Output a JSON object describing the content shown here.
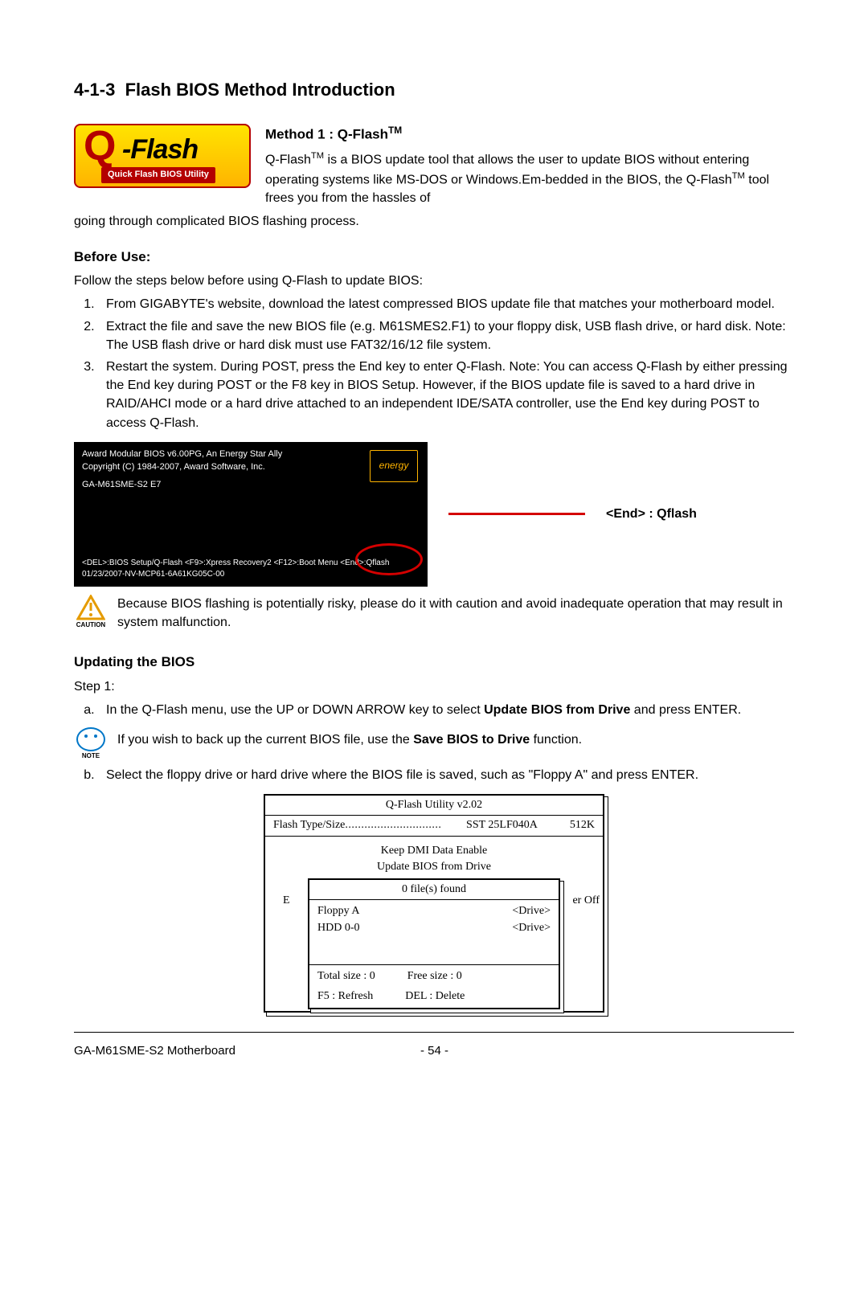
{
  "section": {
    "number": "4-1-3",
    "title": "Flash BIOS Method Introduction"
  },
  "logo": {
    "q": "Q",
    "flash": "-Flash",
    "tag": "Quick Flash BIOS Utility"
  },
  "method1": {
    "heading_prefix": "Method 1 : Q-Flash",
    "tm": "TM",
    "p1a": "Q-Flash",
    "p1b": " is a BIOS update tool that allows the user to update BIOS without entering operating systems like MS-DOS or Windows.Em-bedded in the BIOS, the Q-Flash",
    "p1c": " tool frees you from the hassles of",
    "p2": "going through complicated BIOS flashing process."
  },
  "before": {
    "head": "Before Use:",
    "intro": "Follow the steps below before using Q-Flash to update BIOS:",
    "steps": [
      "From GIGABYTE's website, download the latest compressed BIOS update file that matches your motherboard model.",
      "Extract the file and save the new BIOS file (e.g. M61SMES2.F1) to your floppy disk, USB flash drive, or hard disk. Note: The USB flash drive or hard disk must use FAT32/16/12 file system.",
      "Restart the system. During POST, press the End key to enter Q-Flash.  Note: You can access Q-Flash by either pressing the End key during POST or the F8 key in BIOS Setup. However, if the BIOS update file is saved to a hard drive in RAID/AHCI mode or a hard drive attached to an independent IDE/SATA controller, use the End key during POST to access Q-Flash."
    ]
  },
  "post": {
    "line1": "Award Modular BIOS v6.00PG, An Energy Star Ally",
    "line2": "Copyright (C) 1984-2007, Award Software, Inc.",
    "line3": "GA-M61SME-S2 E7",
    "bottom1": "<DEL>:BIOS Setup/Q-Flash <F9>:Xpress Recovery2 <F12>:Boot Menu <End>:Qflash",
    "bottom2": "01/23/2007-NV-MCP61-6A61KG05C-00",
    "energy": "energy",
    "callout": "<End> : Qflash"
  },
  "caution": {
    "label": "CAUTION",
    "text": "Because BIOS flashing is potentially risky, please do it with caution and avoid inadequate operation that may result in system malfunction."
  },
  "updating": {
    "head": "Updating the BIOS",
    "step1": "Step 1:",
    "a_pre": "In the Q-Flash menu, use the UP or DOWN ARROW key to select ",
    "a_bold": "Update BIOS from Drive",
    "a_post": " and press ENTER.",
    "note_label": "NOTE",
    "note_pre": "If you wish to back up the current BIOS file, use the ",
    "note_bold": "Save BIOS to Drive",
    "note_post": " function.",
    "b": "Select the floppy drive or hard drive where the BIOS file is saved, such as \"Floppy A\" and press ENTER."
  },
  "qutil": {
    "title": "Q-Flash Utility v2.02",
    "row1_left": "Flash Type/Size",
    "row1_mid": "SST 25LF040A",
    "row1_right": "512K",
    "kdmi": "Keep DMI Data    Enable",
    "up": "Update BIOS from Drive",
    "popup_title": "0 file(s) found",
    "drives": [
      {
        "name": "Floppy A",
        "tag": "<Drive>"
      },
      {
        "name": "HDD 0-0",
        "tag": "<Drive>"
      }
    ],
    "total": "Total size : 0",
    "free": "Free size : 0",
    "f5": "F5 : Refresh",
    "del": "DEL : Delete",
    "behind_e": "E",
    "behind_r": "er Off"
  },
  "footer": {
    "left": "GA-M61SME-S2 Motherboard",
    "page": "- 54 -"
  }
}
